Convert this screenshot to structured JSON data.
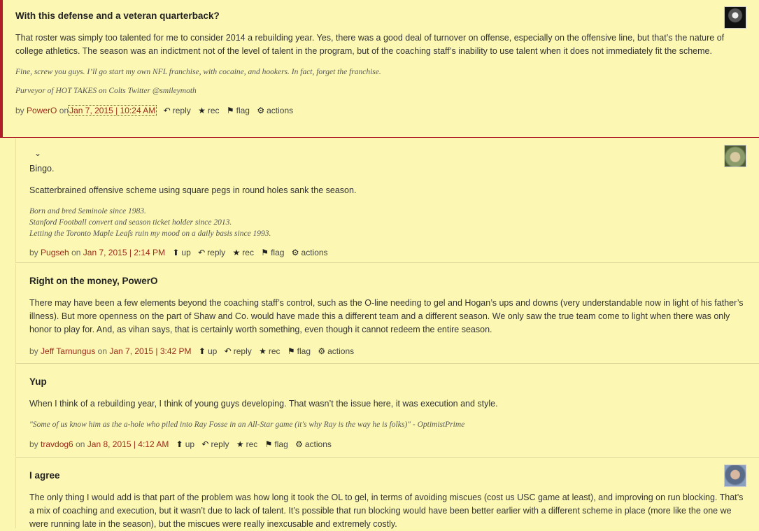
{
  "comments": [
    {
      "title": "With this defense and a veteran quarterback?",
      "paragraphs": [
        "That roster was simply too talented for me to consider 2014 a rebuilding year. Yes, there was a good deal of turnover on offense, especially on the offensive line, but that’s the nature of college athletics. The season was an indictment not of the level of talent in the program, but of the coaching staff’s inability to use talent when it does not immediately fit the scheme."
      ],
      "signature": [
        "Fine, screw you guys. I’ll go start my own NFL franchise, with cocaine, and hookers. In fact, forget the franchise.",
        "Purveyor of HOT TAKES on Colts Twitter @smileymoth"
      ],
      "by": "by",
      "user": "PowerO",
      "on": "on",
      "date": "Jan 7, 2015 | 10:24 AM",
      "actions": {
        "reply": "reply",
        "rec": "rec",
        "flag": "flag",
        "actions": "actions"
      }
    },
    {
      "title": "",
      "paragraphs": [
        "Bingo.",
        "Scatterbrained offensive scheme using square pegs in round holes sank the season."
      ],
      "signature": [
        "Born and bred Seminole since 1983.",
        "Stanford Football convert and season ticket holder since 2013.",
        "Letting the Toronto Maple Leafs ruin my mood on a daily basis since 1993."
      ],
      "by": "by",
      "user": "Pugseh",
      "on": "on",
      "date": "Jan 7, 2015 | 2:14 PM",
      "actions": {
        "up": "up",
        "reply": "reply",
        "rec": "rec",
        "flag": "flag",
        "actions": "actions"
      }
    },
    {
      "title": "Right on the money, PowerO",
      "paragraphs": [
        "There may have been a few elements beyond the coaching staff’s control, such as the O-line needing to gel and Hogan’s ups and downs (very understandable now in light of his father’s illness). But more openness on the part of Shaw and Co. would have made this a different team and a different season. We only saw the true team come to light when there was only honor to play for. And, as vihan says, that is certainly worth something, even though it cannot redeem the entire season."
      ],
      "by": "by",
      "user": "Jeff Tarnungus",
      "on": "on",
      "date": "Jan 7, 2015 | 3:42 PM",
      "actions": {
        "up": "up",
        "reply": "reply",
        "rec": "rec",
        "flag": "flag",
        "actions": "actions"
      }
    },
    {
      "title": "Yup",
      "paragraphs": [
        "When I think of a rebuilding year, I think of young guys developing. That wasn’t the issue here, it was execution and style."
      ],
      "signature": [
        "\"Some of us know him as the a-hole who piled into Ray Fosse in an All-Star game (it's why Ray is the way he is folks)\" - OptimistPrime"
      ],
      "by": "by",
      "user": "travdog6",
      "on": "on",
      "date": "Jan 8, 2015 | 4:12 AM",
      "actions": {
        "up": "up",
        "reply": "reply",
        "rec": "rec",
        "flag": "flag",
        "actions": "actions"
      }
    },
    {
      "title": "I agree",
      "paragraphs": [
        "The only thing I would add is that part of the problem was how long it took the OL to gel, in terms of avoiding miscues (cost us USC game at least), and improving on run blocking. That’s a mix of coaching and execution, but it wasn’t due to lack of talent. It’s possible that run blocking would have been better earlier with a different scheme in place (more like the one we were running late in the season), but the miscues were really inexcusable and extremely costly."
      ]
    }
  ],
  "icons": {
    "collapse": "chevron-down-icon",
    "up": "arrow-up-icon",
    "reply": "reply-arrow-icon",
    "rec": "star-icon",
    "flag": "flag-icon",
    "actions": "gear-icon"
  }
}
